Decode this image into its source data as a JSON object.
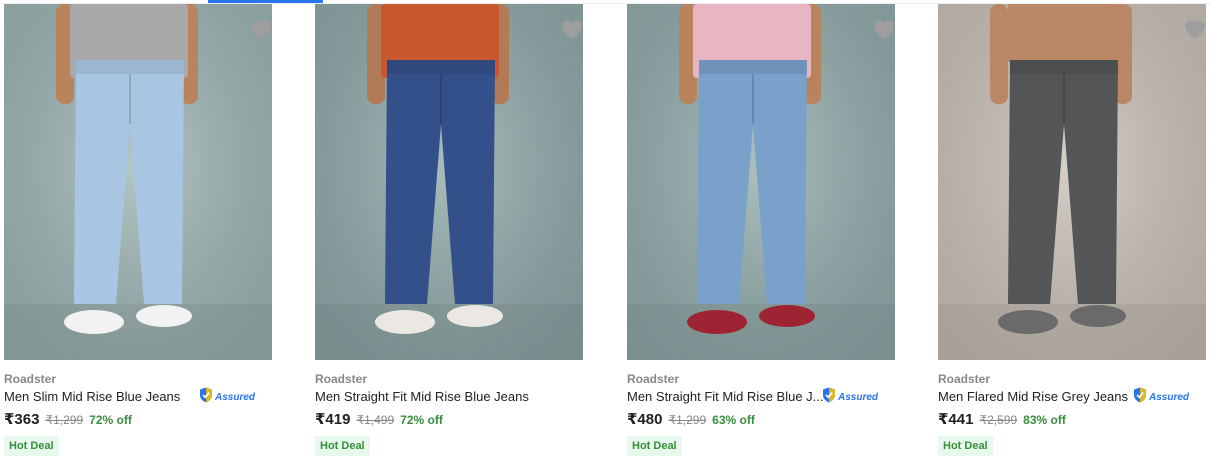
{
  "currency_symbol": "₹",
  "products": [
    {
      "brand": "Roadster",
      "title": "Men Slim Mid Rise Blue Jeans",
      "assured": true,
      "assured_label": "Assured",
      "price": "₹363",
      "mrp": "₹1,299",
      "discount": "72% off",
      "badge": "Hot Deal",
      "image": {
        "bg": "#9db4b4",
        "top": "#a9a9aa",
        "jeans": "#a8c6e2",
        "shoes": "#f2f2f2",
        "skin": "#b9845c"
      }
    },
    {
      "brand": "Roadster",
      "title": "Men Straight Fit Mid Rise Blue Jeans",
      "assured": false,
      "assured_label": "",
      "price": "₹419",
      "mrp": "₹1,499",
      "discount": "72% off",
      "badge": "Hot Deal",
      "image": {
        "bg": "#8fa9a8",
        "top": "#c9582f",
        "jeans": "#33508a",
        "shoes": "#ebe7e2",
        "skin": "#b07b56"
      }
    },
    {
      "brand": "Roadster",
      "title": "Men Straight Fit Mid Rise Blue J...",
      "assured": true,
      "assured_label": "Assured",
      "price": "₹480",
      "mrp": "₹1,299",
      "discount": "63% off",
      "badge": "Hot Deal",
      "image": {
        "bg": "#92acab",
        "top": "#e8b6c3",
        "jeans": "#7aa1c9",
        "shoes": "#9e2333",
        "skin": "#b9845c"
      }
    },
    {
      "brand": "Roadster",
      "title": "Men Flared Mid Rise Grey Jeans",
      "assured": true,
      "assured_label": "Assured",
      "price": "₹441",
      "mrp": "₹2,599",
      "discount": "83% off",
      "badge": "Hot Deal",
      "image": {
        "bg": "#c9c1b8",
        "top": "",
        "jeans": "#545556",
        "shoes": "#6a6a6a",
        "skin": "#b98666"
      }
    }
  ],
  "colors": {
    "accent": "#2874f0",
    "discount_green": "#388e3c",
    "deal_bg": "#e7f8ec",
    "muted": "#878787",
    "heart": "#9e9e9e"
  },
  "icons": {
    "wishlist": "heart-icon",
    "assured": "shield-check-icon"
  }
}
